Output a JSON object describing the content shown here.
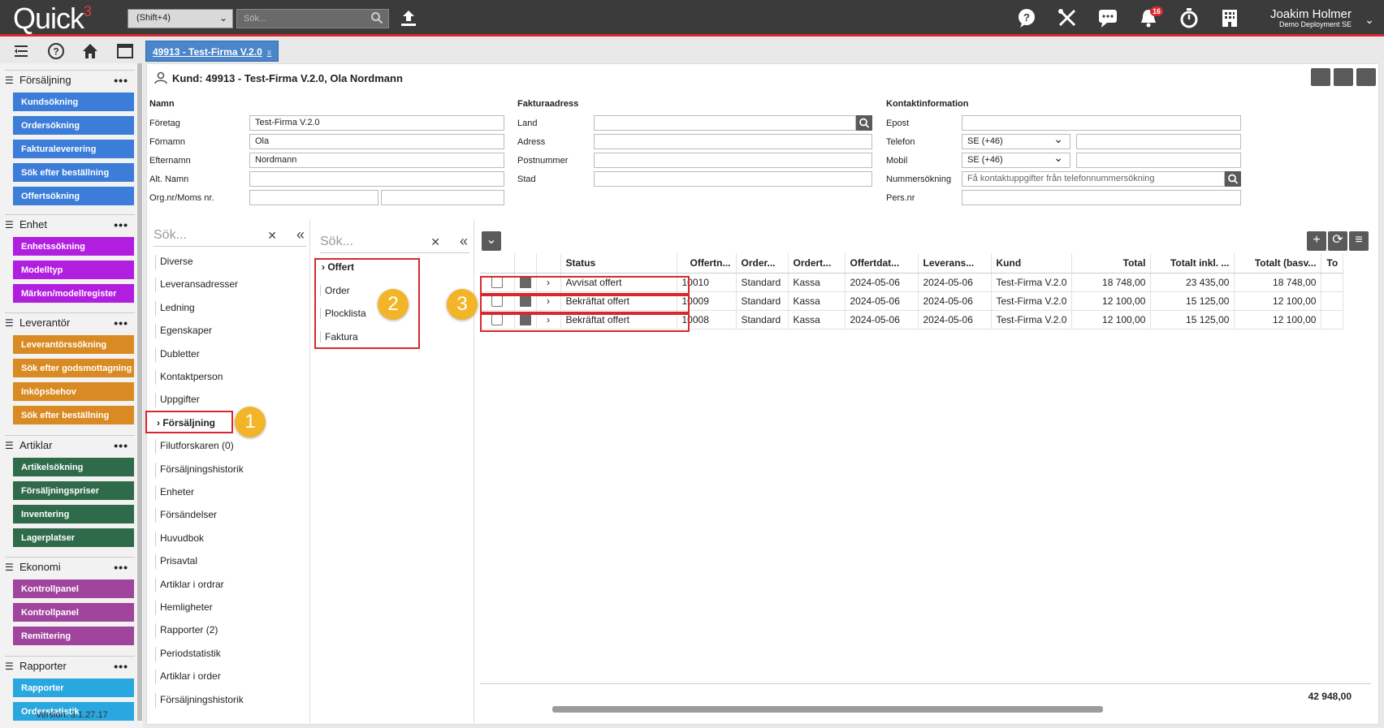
{
  "app": {
    "logo": "Quick",
    "logo_sup": "3"
  },
  "topbar": {
    "shortcut": "(Shift+4)",
    "search_placeholder": "Sök...",
    "notif_count": "16",
    "user_name": "Joakim Holmer",
    "user_sub": "Demo Deployment SE"
  },
  "tab": {
    "label": "49913 - Test-Firma V.2.0",
    "close": "x"
  },
  "sidebar": {
    "groups": [
      {
        "title": "Försäljning",
        "color": "#3b7dd8",
        "items": [
          "Kundsökning",
          "Ordersökning",
          "Fakturaleverering",
          "Sök efter beställning",
          "Offertsökning"
        ]
      },
      {
        "title": "Enhet",
        "color": "#b21ee0",
        "items": [
          "Enhetssökning",
          "Modelltyp",
          "Märken/modellregister"
        ]
      },
      {
        "title": "Leverantör",
        "color": "#d98a22",
        "items": [
          "Leverantörssökning",
          "Sök efter godsmottagning",
          "Inköpsbehov",
          "Sök efter beställning"
        ]
      },
      {
        "title": "Artiklar",
        "color": "#2f6b4b",
        "items": [
          "Artikelsökning",
          "Försäljningspriser",
          "Inventering",
          "Lagerplatser"
        ]
      },
      {
        "title": "Ekonomi",
        "color": "#a0449e",
        "items": [
          "Kontrollpanel",
          "Kontrollpanel",
          "Remittering"
        ]
      },
      {
        "title": "Rapporter",
        "color": "#29a7df",
        "items": [
          "Rapporter",
          "Orderstatistik"
        ]
      }
    ],
    "version": "Version: 3.1.27.17"
  },
  "customer": {
    "title": "Kund: 49913 - Test-Firma V.2.0, Ola Nordmann",
    "name_section": "Namn",
    "invoice_section": "Fakturaadress",
    "contact_section": "Kontaktinformation",
    "foretag_label": "Företag",
    "foretag": "Test-Firma V.2.0",
    "fornamn_label": "Förnamn",
    "fornamn": "Ola",
    "efternamn_label": "Efternamn",
    "efternamn": "Nordmann",
    "altnamn_label": "Alt. Namn",
    "orgnr_label": "Org.nr/Moms nr.",
    "land_label": "Land",
    "adress_label": "Adress",
    "postnummer_label": "Postnummer",
    "stad_label": "Stad",
    "epost_label": "Epost",
    "telefon_label": "Telefon",
    "telefon_cc": "SE (+46)",
    "mobil_label": "Mobil",
    "mobil_cc": "SE (+46)",
    "nummersokning_label": "Nummersökning",
    "nummersokning_placeholder": "Få kontaktuppgifter från telefonnummersökning",
    "persnr_label": "Pers.nr"
  },
  "panel1": {
    "search": "Sök...",
    "items": [
      "Diverse",
      "Leveransadresser",
      "Ledning",
      "Egenskaper",
      "Dubletter",
      "Kontaktperson",
      "Uppgifter",
      "Försäljning",
      "Filutforskaren (0)",
      "Försäljningshistorik",
      "Enheter",
      "Försändelser",
      "Huvudbok",
      "Prisavtal",
      "Artiklar i ordrar",
      "Hemligheter",
      "Rapporter (2)",
      "Periodstatistik",
      "Artiklar i order",
      "Försäljningshistorik"
    ]
  },
  "panel2": {
    "search": "Sök...",
    "items": [
      "Offert",
      "Order",
      "Plocklista",
      "Faktura"
    ]
  },
  "callouts": [
    "1",
    "2",
    "3"
  ],
  "grid": {
    "columns": [
      "Status",
      "Offertn...",
      "Order...",
      "Ordert...",
      "Offertdat...",
      "Leverans...",
      "Kund",
      "Total",
      "Totalt inkl. ...",
      "Totalt (basv...",
      "To"
    ],
    "rows": [
      [
        "Avvisat offert",
        "10010",
        "Standard",
        "Kassa",
        "2024-05-06",
        "2024-05-06",
        "Test-Firma V.2.0",
        "18 748,00",
        "23 435,00",
        "18 748,00"
      ],
      [
        "Bekräftat offert",
        "10009",
        "Standard",
        "Kassa",
        "2024-05-06",
        "2024-05-06",
        "Test-Firma V.2.0",
        "12 100,00",
        "15 125,00",
        "12 100,00"
      ],
      [
        "Bekräftat offert",
        "10008",
        "Standard",
        "Kassa",
        "2024-05-06",
        "2024-05-06",
        "Test-Firma V.2.0",
        "12 100,00",
        "15 125,00",
        "12 100,00"
      ]
    ],
    "footer_total": "42 948,00"
  }
}
